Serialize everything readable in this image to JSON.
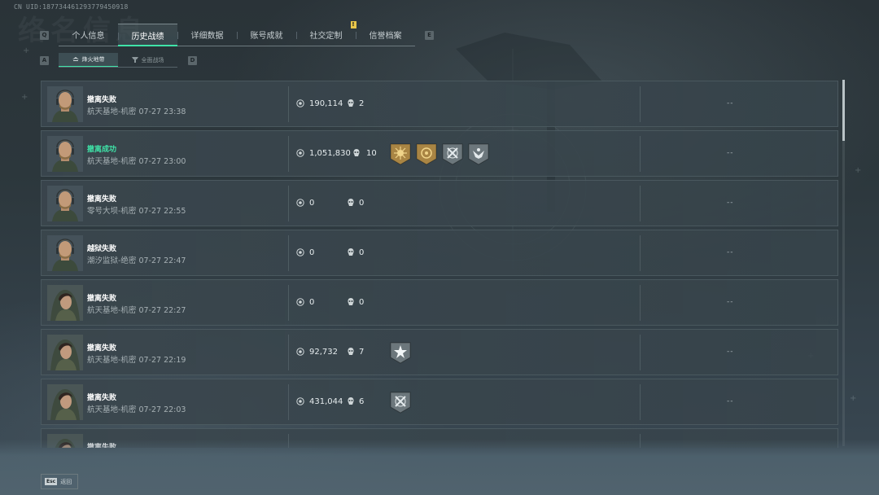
{
  "uid": "CN UID:18773446129377945091​8",
  "watermark": "络名信息",
  "tabs": {
    "left_key": "Q",
    "right_key": "E",
    "items": [
      {
        "label": "个人信息",
        "active": false
      },
      {
        "label": "历史战绩",
        "active": true
      },
      {
        "label": "详细数据",
        "active": false
      },
      {
        "label": "账号成就",
        "active": false
      },
      {
        "label": "社交定制",
        "active": false,
        "badge": "!"
      },
      {
        "label": "信誉档案",
        "active": false
      }
    ]
  },
  "subtabs": {
    "left_key": "A",
    "right_key": "D",
    "items": [
      {
        "label": "烽火地带",
        "active": true
      },
      {
        "label": "全面战场",
        "active": false
      }
    ]
  },
  "rows": [
    {
      "status": "撤离失败",
      "status_type": "fail",
      "map": "航天基地-机密 07-27 23:38",
      "value": "190,114",
      "kills": "2",
      "medals": [],
      "extra": "--",
      "avatar": "male"
    },
    {
      "status": "撤离成功",
      "status_type": "success",
      "map": "航天基地-机密 07-27 23:00",
      "value": "1,051,830",
      "kills": "10",
      "medals": [
        "gold-sun",
        "gold-target",
        "silver-crossed",
        "silver-eagle"
      ],
      "extra": "--",
      "avatar": "male"
    },
    {
      "status": "撤离失败",
      "status_type": "fail",
      "map": "零号大坝-机密 07-27 22:55",
      "value": "0",
      "kills": "0",
      "medals": [],
      "extra": "--",
      "avatar": "male"
    },
    {
      "status": "越狱失败",
      "status_type": "fail",
      "map": "潮汐监狱-绝密 07-27 22:47",
      "value": "0",
      "kills": "0",
      "medals": [],
      "extra": "--",
      "avatar": "male"
    },
    {
      "status": "撤离失败",
      "status_type": "fail",
      "map": "航天基地-机密 07-27 22:27",
      "value": "0",
      "kills": "0",
      "medals": [],
      "extra": "--",
      "avatar": "female"
    },
    {
      "status": "撤离失败",
      "status_type": "fail",
      "map": "航天基地-机密 07-27 22:19",
      "value": "92,732",
      "kills": "7",
      "medals": [
        "silver-star"
      ],
      "extra": "--",
      "avatar": "female"
    },
    {
      "status": "撤离失败",
      "status_type": "fail",
      "map": "航天基地-机密 07-27 22:03",
      "value": "431,044",
      "kills": "6",
      "medals": [
        "silver-crossed"
      ],
      "extra": "--",
      "avatar": "female"
    },
    {
      "status": "撤离失败",
      "status_type": "fail",
      "map": "",
      "value": "",
      "kills": "",
      "medals": [],
      "extra": "",
      "avatar": "female"
    }
  ],
  "footer": {
    "key": "Esc",
    "label": "返回"
  },
  "colors": {
    "accent": "#3fe3a8",
    "success": "#3fe3a8",
    "badge": "#e8c64a",
    "gold_medal": "#b08a3e",
    "silver_medal": "#7f8a8f"
  }
}
